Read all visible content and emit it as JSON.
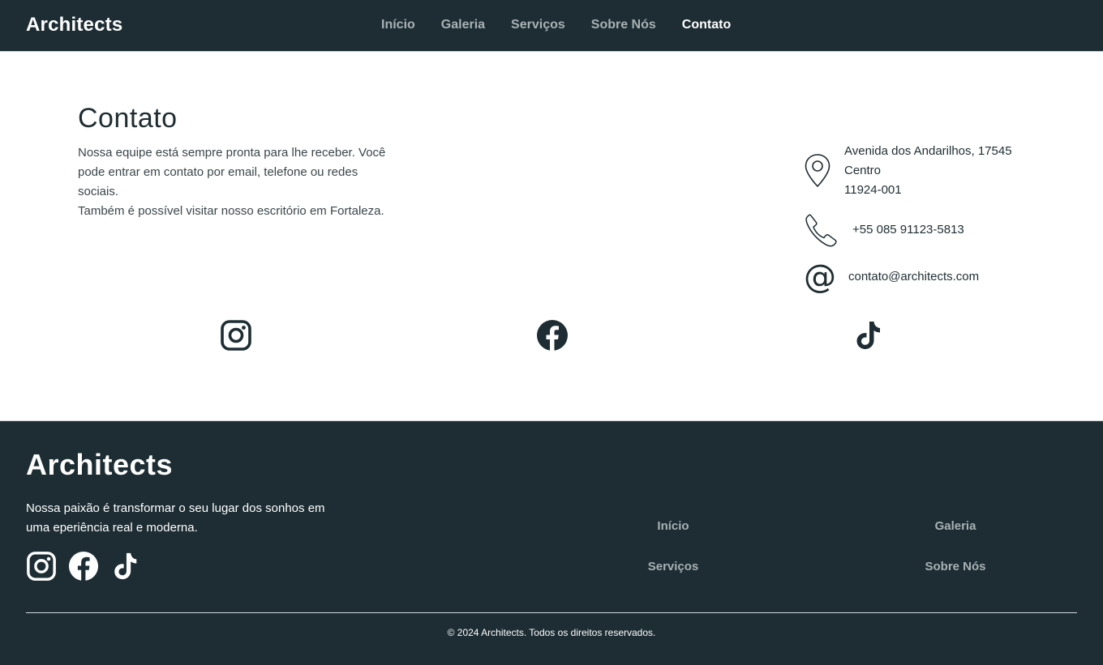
{
  "header": {
    "brand": "Architects",
    "nav": [
      {
        "label": "Início"
      },
      {
        "label": "Galeria"
      },
      {
        "label": "Serviços"
      },
      {
        "label": "Sobre Nós"
      },
      {
        "label": "Contato",
        "active": true
      }
    ]
  },
  "contact": {
    "title": "Contato",
    "paragraph1": "Nossa equipe está sempre pronta para lhe receber. Você pode entrar em contato por email, telefone ou redes sociais.",
    "paragraph2": "Também é possível visitar nosso escritório em Fortaleza.",
    "address_line1": "Avenida dos Andarilhos, 17545",
    "address_line2": "Centro",
    "address_line3": "11924-001",
    "phone": "+55 085 91123-5813",
    "at_symbol": "@",
    "email": "contato@architects.com",
    "icons": [
      "map-pin-icon",
      "phone-icon",
      "at-icon"
    ]
  },
  "social": [
    "instagram-icon",
    "facebook-icon",
    "tiktok-icon"
  ],
  "footer": {
    "brand": "Architects",
    "tagline": "Nossa paixão é transformar o seu lugar dos sonhos em uma eperiência real e moderna.",
    "links": [
      "Início",
      "Galeria",
      "Serviços",
      "Sobre Nós"
    ],
    "copyright": "© 2024 Architects. Todos os direitos reservados."
  },
  "colors": {
    "dark": "#1d2d33",
    "nav_inactive": "#a8b1b4",
    "text": "#1f2d31",
    "white": "#ffffff"
  }
}
